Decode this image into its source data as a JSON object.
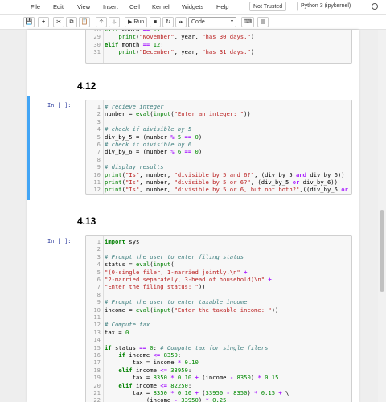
{
  "menubar": {
    "items": [
      "File",
      "Edit",
      "View",
      "Insert",
      "Cell",
      "Kernel",
      "Widgets",
      "Help"
    ],
    "trust_label": "Not Trusted",
    "kernel_label": "Python 3 (ipykernel)"
  },
  "toolbar": {
    "run_label": "Run",
    "cell_type": "Code",
    "icons": [
      "save-icon",
      "add-cell-icon",
      "cut-icon",
      "copy-icon",
      "paste-icon",
      "move-up-icon",
      "move-down-icon",
      "run-icon",
      "stop-icon",
      "restart-icon",
      "restart-run-all-icon",
      "keyboard-icon",
      "command-palette-icon"
    ]
  },
  "cells": {
    "c0": {
      "lines": [
        {
          "n": "28",
          "code": "elif month == 11:"
        },
        {
          "n": "29",
          "code": "    print(\"November\", year, \"has 30 days.\")"
        },
        {
          "n": "30",
          "code": "elif month == 12:"
        },
        {
          "n": "31",
          "code": "    print(\"December\", year, \"has 31 days.\")"
        }
      ]
    },
    "h1": {
      "text": "4.12"
    },
    "c1": {
      "prompt": "In [ ]:",
      "lines": [
        {
          "n": "1",
          "code": "# recieve integer"
        },
        {
          "n": "2",
          "code": "number = eval(input(\"Enter an integer: \"))"
        },
        {
          "n": "3",
          "code": ""
        },
        {
          "n": "4",
          "code": "# check if divisible by 5"
        },
        {
          "n": "5",
          "code": "div_by_5 = (number % 5 == 0)"
        },
        {
          "n": "6",
          "code": "# check if divisible by 6"
        },
        {
          "n": "7",
          "code": "div_by_6 = (number % 6 == 0)"
        },
        {
          "n": "8",
          "code": ""
        },
        {
          "n": "9",
          "code": "# display results"
        },
        {
          "n": "10",
          "code": "print(\"Is\", number, \"divisible by 5 and 6?\", (div_by_5 and div_by_6))"
        },
        {
          "n": "11",
          "code": "print(\"Is\", number, \"divisible by 5 or 6?\", (div_by_5 or div_by_6))"
        },
        {
          "n": "12",
          "code": "print(\"Is\", number, \"divisible by 5 or 6, but not both?\",((div_by_5 or d"
        }
      ]
    },
    "h2": {
      "text": "4.13"
    },
    "c2": {
      "prompt": "In [ ]:",
      "lines": [
        {
          "n": "1",
          "code": "import sys"
        },
        {
          "n": "2",
          "code": ""
        },
        {
          "n": "3",
          "code": "# Prompt the user to enter filing status"
        },
        {
          "n": "4",
          "code": "status = eval(input("
        },
        {
          "n": "5",
          "code": "\"(0-single filer, 1-married jointly,\\n\" +"
        },
        {
          "n": "6",
          "code": "\"2-married separately, 3-head of household)\\n\" +"
        },
        {
          "n": "7",
          "code": "\"Enter the filing status: \"))"
        },
        {
          "n": "8",
          "code": ""
        },
        {
          "n": "9",
          "code": "# Prompt the user to enter taxable income"
        },
        {
          "n": "10",
          "code": "income = eval(input(\"Enter the taxable income: \"))"
        },
        {
          "n": "11",
          "code": ""
        },
        {
          "n": "12",
          "code": "# Compute tax"
        },
        {
          "n": "13",
          "code": "tax = 0"
        },
        {
          "n": "14",
          "code": ""
        },
        {
          "n": "15",
          "code": "if status == 0: # Compute tax for single filers"
        },
        {
          "n": "16",
          "code": "    if income <= 8350:"
        },
        {
          "n": "17",
          "code": "        tax = income * 0.10"
        },
        {
          "n": "18",
          "code": "    elif income <= 33950:"
        },
        {
          "n": "19",
          "code": "        tax = 8350 * 0.10 + (income - 8350) * 0.15"
        },
        {
          "n": "20",
          "code": "    elif income <= 82250:"
        },
        {
          "n": "21",
          "code": "        tax = 8350 * 0.10 + (33950 - 8350) * 0.15 + \\"
        },
        {
          "n": "22",
          "code": "            (income - 33950) * 0.25"
        }
      ]
    }
  },
  "scroll": {
    "position": 0.62,
    "visible": 0.22
  }
}
